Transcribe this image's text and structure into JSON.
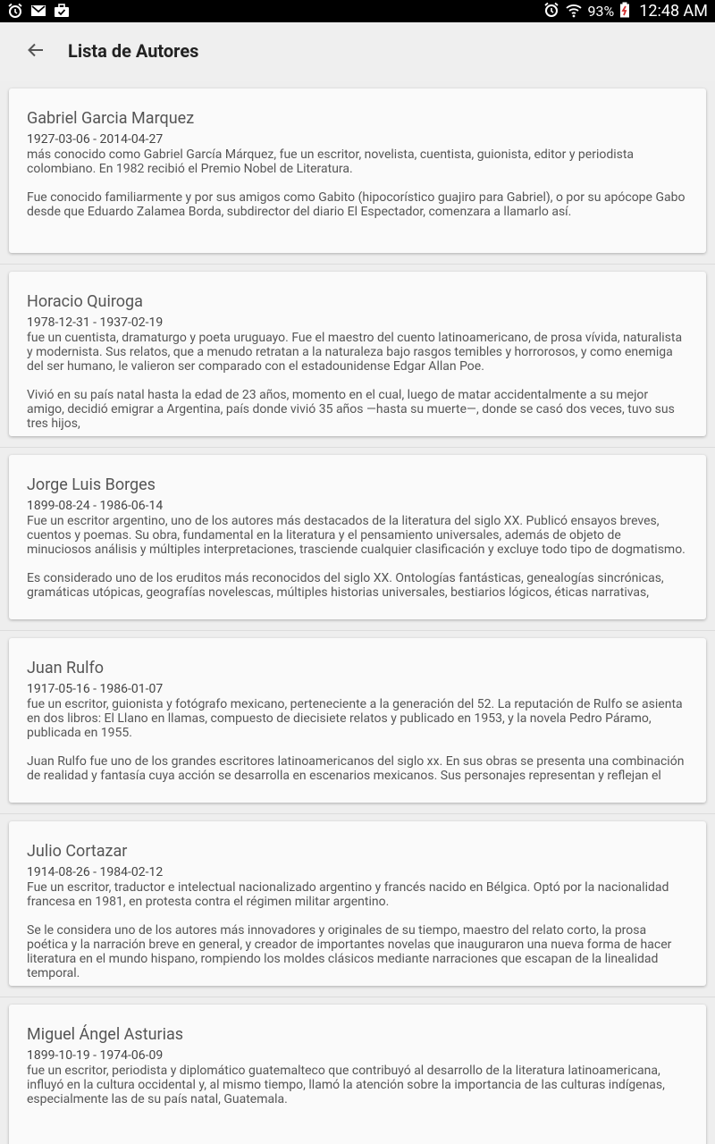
{
  "status_bar": {
    "battery": "93%",
    "time": "12:48 AM"
  },
  "app_bar": {
    "title": "Lista de Autores"
  },
  "authors": [
    {
      "name": "Gabriel Garcia Marquez",
      "dates": "1927-03-06 - 2014-04-27",
      "bio": "más conocido como Gabriel García Márquez, fue un escritor, novelista, cuentista, guionista, editor y periodista colombiano. En 1982 recibió el Premio Nobel de Literatura.\n\nFue conocido familiarmente y por sus amigos como Gabito (hipocorístico guajiro para Gabriel), o por su apócope Gabo desde que Eduardo Zalamea Borda, subdirector del diario El Espectador, comenzara a llamarlo así."
    },
    {
      "name": "Horacio Quiroga",
      "dates": "1978-12-31 - 1937-02-19",
      "bio": "fue un cuentista, dramaturgo y poeta uruguayo. Fue el maestro del cuento latinoamericano, de prosa vívida, naturalista y modernista. Sus relatos, que a menudo retratan a la naturaleza bajo rasgos temibles y horrorosos, y como enemiga del ser humano, le valieron ser comparado con el estadounidense Edgar Allan Poe.\n\nVivió en su país natal hasta la edad de 23 años, momento en el cual, luego de matar accidentalmente a su mejor amigo, decidió emigrar a Argentina, país donde vivió 35 años —hasta su muerte—, donde se casó dos veces, tuvo sus tres hijos,"
    },
    {
      "name": "Jorge Luis Borges",
      "dates": "1899-08-24 - 1986-06-14",
      "bio": "Fue un escritor argentino, uno de los autores más destacados de la literatura del siglo XX. Publicó ensayos breves, cuentos y poemas. Su obra, fundamental en la literatura y el pensamiento universales, además de objeto de minuciosos análisis y múltiples interpretaciones, trasciende cualquier clasificación y excluye todo tipo de dogmatismo.\n\nEs considerado uno de los eruditos más reconocidos del siglo XX. Ontologías fantásticas, genealogías sincrónicas, gramáticas utópicas, geografías novelescas, múltiples historias universales, bestiarios lógicos, éticas narrativas,"
    },
    {
      "name": "Juan Rulfo",
      "dates": "1917-05-16 - 1986-01-07",
      "bio": "fue un escritor, guionista y fotógrafo mexicano, perteneciente a la generación del 52. La reputación de Rulfo se asienta en dos libros: El Llano en llamas, compuesto de diecisiete relatos y publicado en 1953, y la novela Pedro Páramo, publicada en 1955.\n\nJuan Rulfo fue uno de los grandes escritores latinoamericanos del siglo xx. En sus obras se presenta una combinación de realidad y fantasía cuya acción se desarrolla en escenarios mexicanos. Sus personajes representan y reflejan el"
    },
    {
      "name": "Julio Cortazar",
      "dates": "1914-08-26 - 1984-02-12",
      "bio": "Fue un escritor, traductor e intelectual nacionalizado argentino y francés nacido en Bélgica. Optó por la nacionalidad francesa en 1981, en protesta contra el régimen militar argentino.\n\nSe le considera uno de los autores más innovadores y originales de su tiempo, maestro del relato corto, la prosa poética y la narración breve en general, y creador de importantes novelas que inauguraron una nueva forma de hacer literatura en el mundo hispano, rompiendo los moldes clásicos mediante narraciones que escapan de la linealidad temporal."
    },
    {
      "name": "Miguel Ángel Asturias",
      "dates": "1899-10-19 - 1974-06-09",
      "bio": "fue un escritor, periodista y diplomático guatemalteco que contribuyó al desarrollo de la literatura latinoamericana, influyó en la cultura occidental y, al mismo tiempo, llamó la atención sobre la importancia de las culturas indígenas, especialmente las de su país natal, Guatemala."
    }
  ]
}
